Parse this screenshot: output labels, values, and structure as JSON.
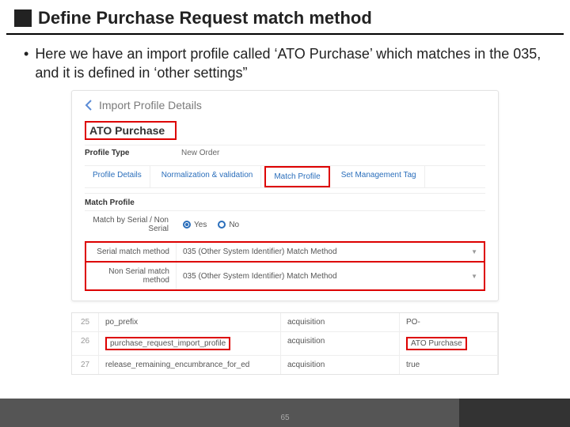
{
  "title": "Define Purchase Request match method",
  "bullet": "Here we have an import profile called ‘ATO Purchase’ which matches in the 035, and it is defined in ‘other settings”",
  "ss": {
    "back_label": "Import Profile Details",
    "profile_name": "ATO Purchase",
    "profile_type_label": "Profile Type",
    "profile_type_value": "New Order",
    "tabs": {
      "t1": "Profile Details",
      "t2": "Normalization & validation",
      "t3": "Match Profile",
      "t4": "Set Management Tag"
    },
    "section_match": "Match Profile",
    "radio_label": "Match by Serial / Non Serial",
    "radio_yes": "Yes",
    "radio_no": "No",
    "serial_label": "Serial match method",
    "nonserial_label": "Non Serial match method",
    "dd_value": "035 (Other System Identifier) Match Method"
  },
  "table": {
    "rows": [
      {
        "idx": "25",
        "key": "po_prefix",
        "mod": "acquisition",
        "val": "PO-"
      },
      {
        "idx": "26",
        "key": "purchase_request_import_profile",
        "mod": "acquisition",
        "val": "ATO Purchase"
      },
      {
        "idx": "27",
        "key": "release_remaining_encumbrance_for_ed",
        "mod": "acquisition",
        "val": "true"
      }
    ]
  },
  "page_number": "65"
}
